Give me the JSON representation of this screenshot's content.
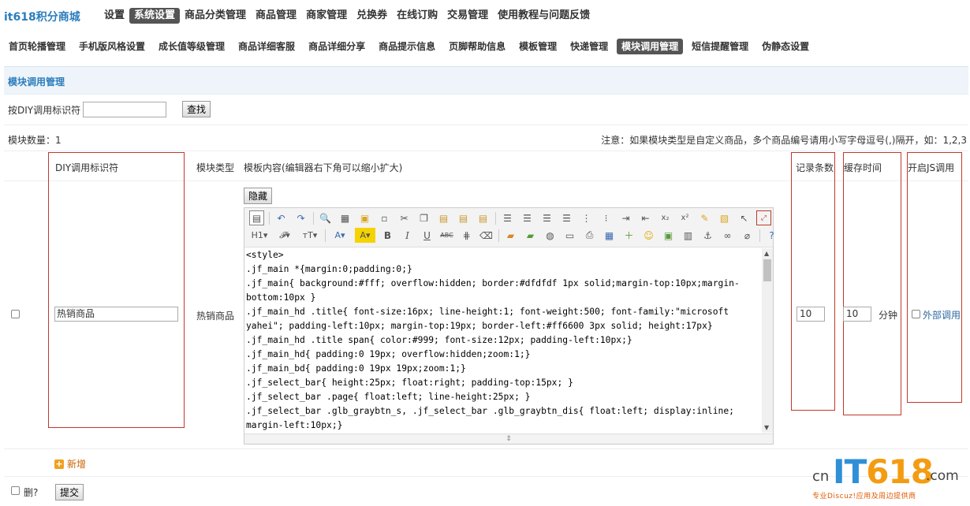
{
  "app": {
    "logo": "it618积分商城"
  },
  "top_nav": [
    {
      "label": "设置",
      "active": false
    },
    {
      "label": "系统设置",
      "active": true
    },
    {
      "label": "商品分类管理",
      "active": false
    },
    {
      "label": "商品管理",
      "active": false
    },
    {
      "label": "商家管理",
      "active": false
    },
    {
      "label": "兑换券",
      "active": false
    },
    {
      "label": "在线订购",
      "active": false
    },
    {
      "label": "交易管理",
      "active": false
    },
    {
      "label": "使用教程与问题反馈",
      "active": false
    }
  ],
  "sub_nav": [
    {
      "label": "首页轮播管理",
      "active": false
    },
    {
      "label": "手机版风格设置",
      "active": false
    },
    {
      "label": "成长值等级管理",
      "active": false
    },
    {
      "label": "商品详细客服",
      "active": false
    },
    {
      "label": "商品详细分享",
      "active": false
    },
    {
      "label": "商品提示信息",
      "active": false
    },
    {
      "label": "页脚帮助信息",
      "active": false
    },
    {
      "label": "模板管理",
      "active": false
    },
    {
      "label": "快递管理",
      "active": false
    },
    {
      "label": "模块调用管理",
      "active": true
    },
    {
      "label": "短信提醒管理",
      "active": false
    },
    {
      "label": "伪静态设置",
      "active": false
    }
  ],
  "section": {
    "title": "模块调用管理"
  },
  "search": {
    "label": "按DIY调用标识符",
    "value": "",
    "button": "查找"
  },
  "summary": {
    "count_label": "模块数量：1",
    "note": "注意：如果模块类型是自定义商品，多个商品编号请用小写字母逗号(,)隔开，如：1,2,3"
  },
  "table": {
    "headers": {
      "diy_id": "DIY调用标识符",
      "type": "模块类型",
      "content": "模板内容(编辑器右下角可以缩小扩大)",
      "records": "记录条数",
      "cache": "缓存时间",
      "js": "开启JS调用"
    },
    "row": {
      "diy_id": "热销商品",
      "type": "热销商品",
      "hide_button": "隐藏",
      "records": "10",
      "cache": "10",
      "cache_unit": "分钟",
      "js_label": "外部调用",
      "code": "<style>\n.jf_main *{margin:0;padding:0;}\n.jf_main{ background:#fff; overflow:hidden; border:#dfdfdf 1px solid;margin-top:10px;margin-bottom:10px }\n.jf_main_hd .title{ font-size:16px; line-height:1; font-weight:500; font-family:\"microsoft yahei\"; padding-left:10px; margin-top:19px; border-left:#ff6600 3px solid; height:17px}\n.jf_main_hd .title span{ color:#999; font-size:12px; padding-left:10px;}\n.jf_main_hd{ padding:0 19px; overflow:hidden;zoom:1;}\n.jf_main_bd{ padding:0 19px 19px;zoom:1;}\n.jf_select_bar{ height:25px; float:right; padding-top:15px; }\n.jf_select_bar .page{ float:left; line-height:25px; }\n.jf_select_bar .glb_graybtn_s, .jf_select_bar .glb_graybtn_dis{ float:left; display:inline; margin-left:10px;}"
    }
  },
  "actions": {
    "add": "新增",
    "delete_label": "删?",
    "submit": "提交"
  },
  "editor_toolbar": {
    "row1": [
      "source-icon",
      "undo-icon",
      "redo-icon",
      "preview-icon",
      "print-icon",
      "template-icon",
      "paste-word-icon",
      "cut-icon",
      "copy-icon",
      "paste-icon",
      "paste-text-icon",
      "paste-html-icon",
      "align-left-icon",
      "align-center-icon",
      "align-right-icon",
      "justify-icon",
      "ordered-list-icon",
      "unordered-list-icon",
      "indent-icon",
      "outdent-icon",
      "subscript-icon",
      "superscript-icon",
      "clear-format-icon",
      "select-all-icon",
      "select-icon",
      "fullscreen-icon"
    ],
    "row2": [
      "heading-icon",
      "font-family-icon",
      "font-size-icon",
      "font-color-icon",
      "highlight-icon",
      "bold-icon",
      "italic-icon",
      "underline-icon",
      "strikethrough-icon",
      "line-height-icon",
      "remove-format-icon",
      "image-icon",
      "multi-image-icon",
      "flash-icon",
      "media-icon",
      "insert-file-icon",
      "table-icon",
      "hr-icon",
      "emoticon-icon",
      "map-icon",
      "pagebreak-icon",
      "anchor-icon",
      "link-icon",
      "unlink-icon",
      "help-icon"
    ]
  },
  "watermark": {
    "cn": "cn",
    "it": "IT",
    "num": "618",
    "com": ".com",
    "slogan": "专业Discuz!应用及周边提供商"
  }
}
